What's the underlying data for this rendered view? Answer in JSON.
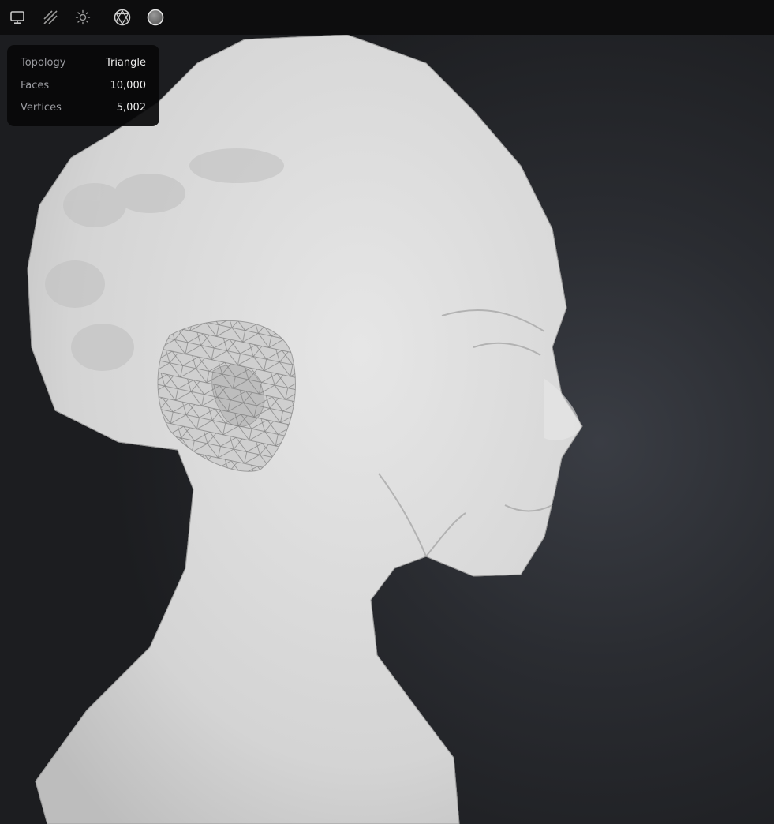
{
  "toolbar": {
    "buttons": [
      {
        "name": "monitor-icon"
      },
      {
        "name": "wireframe-hatch-icon"
      },
      {
        "name": "light-icon"
      },
      {
        "name": "topology-icon"
      },
      {
        "name": "matcap-sphere-icon"
      }
    ]
  },
  "info": {
    "rows": [
      {
        "label": "Topology",
        "value": "Triangle"
      },
      {
        "label": "Faces",
        "value": "10,000"
      },
      {
        "label": "Vertices",
        "value": "5,002"
      }
    ]
  },
  "colors": {
    "toolbar_bg": "#0d0d0e",
    "panel_bg": "#080809",
    "mesh_fill": "#d9d9d9",
    "wire": "#7a7a7a",
    "icon": "#c8c8c8"
  }
}
